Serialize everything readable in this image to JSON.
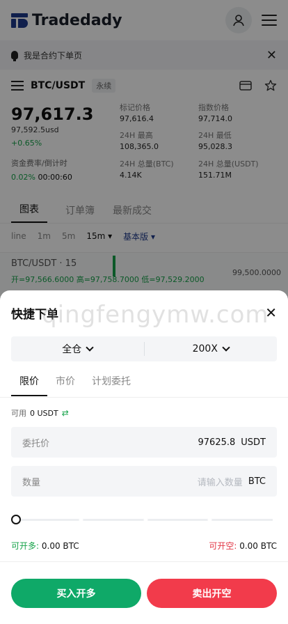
{
  "app": {
    "brand": "Tradedady"
  },
  "notice": {
    "text": "我是合约下单页"
  },
  "pair": {
    "name": "BTC/USDT",
    "tag": "永续"
  },
  "stats": {
    "last_price": "97,617.3",
    "usd_price": "97,592.5usd",
    "change": "+0.65%",
    "funding_label": "资金费率/倒计时",
    "funding_rate": "0.02%",
    "countdown": "00:00:60",
    "grid": [
      {
        "label": "标记价格",
        "value": "97,616.4"
      },
      {
        "label": "指数价格",
        "value": "97,714.0"
      },
      {
        "label": "24H 最高",
        "value": "108,365.0"
      },
      {
        "label": "24H 最低",
        "value": "95,028.3"
      },
      {
        "label": "24H 总量(BTC)",
        "value": "4.14K"
      },
      {
        "label": "24H 总量(USDT)",
        "value": "151.71M"
      }
    ]
  },
  "chart_tabs": [
    "图表",
    "订单簿",
    "最新成交"
  ],
  "intervals": {
    "items": [
      "line",
      "1m",
      "5m",
      "15m"
    ],
    "selected": "15m",
    "mode": "基本版"
  },
  "chart": {
    "title": "BTC/USDT · 15",
    "open_label": "开=97,566.6000",
    "high_label": "高=97,758.7000",
    "low_label": "低=97,529.2000",
    "axis_price": "99,500.0000"
  },
  "sheet": {
    "title": "快捷下单",
    "margin_mode": "全仓",
    "leverage": "200X",
    "order_tabs": [
      "限价",
      "市价",
      "计划委托"
    ],
    "available_label": "可用",
    "available_value": "0 USDT",
    "price_label": "委托价",
    "price_value": "97625.8",
    "price_unit": "USDT",
    "qty_label": "数量",
    "qty_placeholder": "请输入数量",
    "qty_unit": "BTC",
    "long_label": "可开多:",
    "long_value": "0.00 BTC",
    "short_label": "可开空:",
    "short_value": "0.00 BTC",
    "buy_label": "买入开多",
    "sell_label": "卖出开空"
  },
  "watermark": "qingfengymw.com",
  "colors": {
    "buy": "#0fa968",
    "sell": "#f23b4b",
    "up": "#16a34a",
    "brand": "#1e3a8a"
  }
}
